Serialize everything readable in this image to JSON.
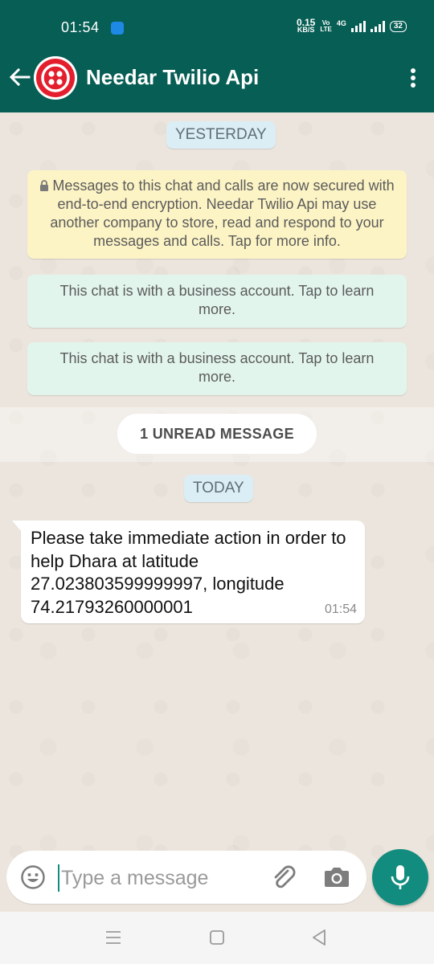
{
  "status_bar": {
    "time": "01:54",
    "speed_value": "0.15",
    "speed_unit": "KB/S",
    "volte_top": "Vo",
    "volte_bottom": "LTE",
    "network": "4G",
    "battery": "32"
  },
  "header": {
    "title": "Needar Twilio Api",
    "avatar_color": "#e31e2d",
    "bar_color": "#075e54"
  },
  "chat": {
    "date_yesterday": "YESTERDAY",
    "encryption_notice": "Messages to this chat and calls are now secured with end-to-end encryption. Needar Twilio Api may use another company to store, read and respond to your messages and calls. Tap for more info.",
    "business_notices": [
      "This chat is with a business account. Tap to learn more.",
      "This chat is with a business account. Tap to learn more."
    ],
    "unread_label": "1 UNREAD MESSAGE",
    "date_today": "TODAY",
    "messages": [
      {
        "text": "Please take immediate action in order to help Dhara at latitude 27.023803599999997, longitude 74.21793260000001",
        "time": "01:54"
      }
    ]
  },
  "composer": {
    "placeholder": "Type a message",
    "accent_color": "#128c7e"
  },
  "icons": [
    "back-arrow-icon",
    "twilio-logo-icon",
    "more-vert-icon",
    "lock-icon",
    "emoji-icon",
    "attach-icon",
    "camera-icon",
    "mic-icon",
    "nav-menu-icon",
    "nav-home-icon",
    "nav-back-icon"
  ]
}
